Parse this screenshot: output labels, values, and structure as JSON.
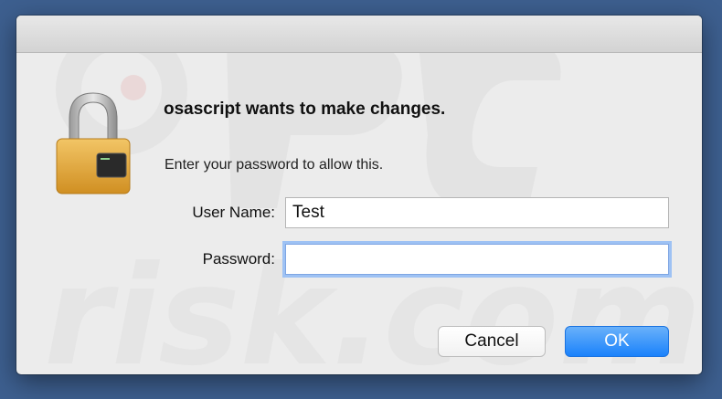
{
  "dialog": {
    "heading": "osascript wants to make changes.",
    "message": "Enter your password to allow this.",
    "icon": "lock-terminal-icon"
  },
  "fields": {
    "username_label": "User Name:",
    "username_value": "Test",
    "password_label": "Password:",
    "password_value": ""
  },
  "buttons": {
    "cancel_label": "Cancel",
    "ok_label": "OK"
  },
  "watermark": {
    "text": "risk.com"
  },
  "colors": {
    "desktop": "#3d5f8f",
    "dialog_bg": "#ececec",
    "ok_button": "#1a82fb",
    "focus_ring": "#9ec2f4",
    "lock_gold": "#e3a63a"
  }
}
